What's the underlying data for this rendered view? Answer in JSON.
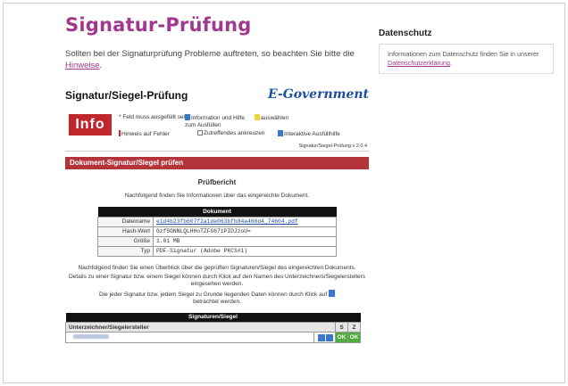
{
  "page": {
    "title": "Signatur-Prüfung",
    "intro_text": "Sollten bei der Signaturprüfung Probleme auftreten, so beachten Sie bitte die ",
    "intro_link": "Hinweise",
    "intro_end": "."
  },
  "sidebar": {
    "title": "Datenschutz",
    "text": "Informationen zum Datenschutz finden Sie in unserer ",
    "link": "Datenschutzerklärung",
    "end": "."
  },
  "egov": {
    "heading": "Signatur/Siegel-Prüfung",
    "brand": "E-Government",
    "info_button": "Info",
    "legend": {
      "required": "* Feld muss ausgefüllt sein",
      "info_help": "Information und Hilfe zum Ausfüllen",
      "select": "auswählen",
      "error_hint": "Hinweis auf Fehler",
      "tick": "Zutreffendes ankreuzen",
      "interactive": "Interaktive Ausfüllhilfe"
    },
    "version": "Signatur/Siegel-Prüfung v 2.0.4",
    "section_title": "Dokument-Signatur/Siegel prüfen",
    "report_title": "Prüfbericht",
    "report_sub": "Nachfolgend finden Sie Informationen über das eingereichte Dokument.",
    "doc_table": {
      "header": "Dokument",
      "rows": [
        {
          "label": "Dateiname",
          "value": "e1d4b23fb607f2a1de063bfb84a468d4_74604.pdf"
        },
        {
          "label": "Hash-Wert",
          "value": "GzfSGNNLQLHHoTZFG671PIDJzoU="
        },
        {
          "label": "Größe",
          "value": "1.01 MB"
        },
        {
          "label": "Typ",
          "value": "PDF-Signatur (Adobe PKCS#1)"
        }
      ]
    },
    "note_overview": "Nachfolgend finden Sie einen Überblick über die geprüften Signaturen/Siegel des eingereichten Dokuments.",
    "note_details": "Details zu einer Signatur bzw. einem Siegel können durch Klick auf den Namen des Unterzeichners/Siegelerstellers eingesehen werden.",
    "note_data": "Die jeder Signatur bzw. jedem Siegel zu Grunde liegenden Daten können durch Klick auf",
    "note_data_end": "betrachtet werden.",
    "sig_table": {
      "header": "Signaturen/Siegel",
      "col_signer": "Unterzeichner/Siegelersteller",
      "col_s": "S",
      "col_z": "Z",
      "row": {
        "s": "OK",
        "z": "OK"
      }
    }
  }
}
